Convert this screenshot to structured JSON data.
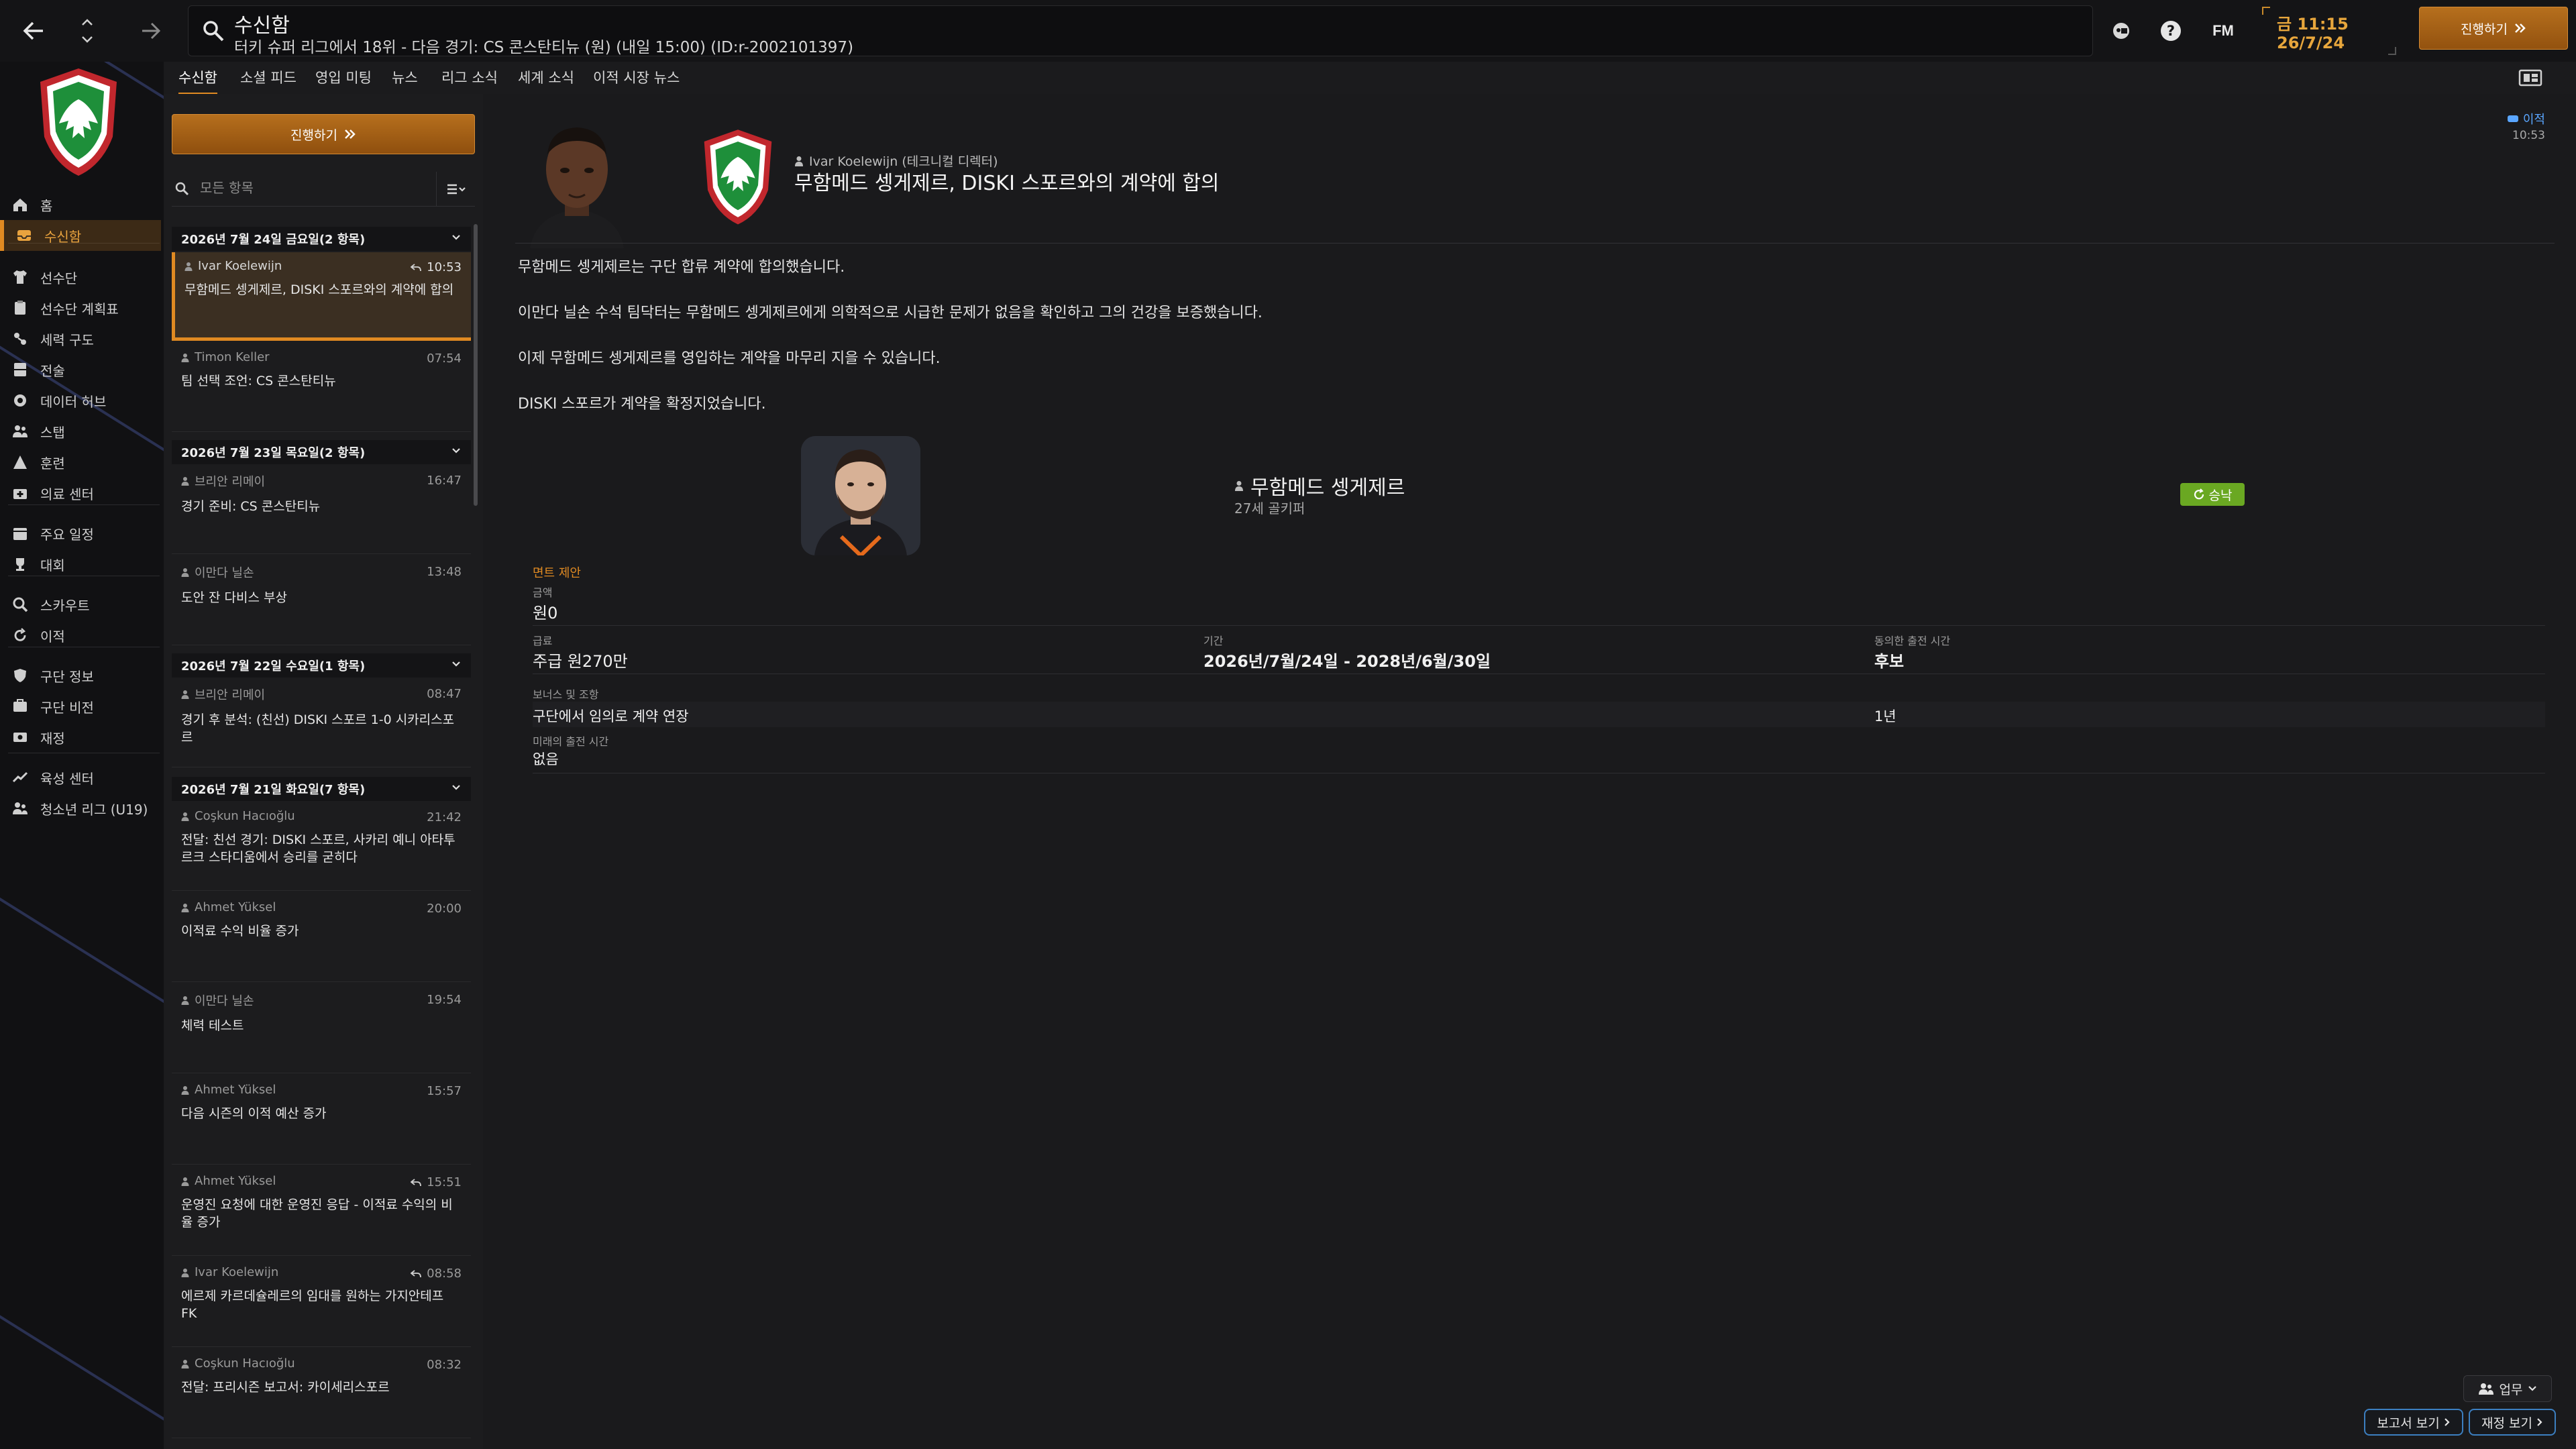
{
  "topbar": {
    "title": "수신함",
    "subtitle": "터키 슈퍼 리그에서 18위 - 다음 경기: CS 콘스탄티뉴 (원) (내일 15:00) (ID:r-2002101397)",
    "fm_logo": "FM",
    "time": "금 11:15",
    "date": "26/7/24",
    "continue_label": "진행하기"
  },
  "sidebar": {
    "items": [
      {
        "label": "홈",
        "icon": "home-icon"
      },
      {
        "label": "수신함",
        "icon": "inbox-icon",
        "active": true
      },
      {
        "label": "선수단",
        "icon": "shirt-icon"
      },
      {
        "label": "선수단 계획표",
        "icon": "clipboard-icon"
      },
      {
        "label": "세력 구도",
        "icon": "dynamics-icon"
      },
      {
        "label": "전술",
        "icon": "tactics-icon"
      },
      {
        "label": "데이터 허브",
        "icon": "data-hub-icon"
      },
      {
        "label": "스탭",
        "icon": "staff-icon"
      },
      {
        "label": "훈련",
        "icon": "training-icon"
      },
      {
        "label": "의료 센터",
        "icon": "medical-icon"
      },
      {
        "label": "주요 일정",
        "icon": "calendar-icon"
      },
      {
        "label": "대회",
        "icon": "trophy-icon"
      },
      {
        "label": "스카우트",
        "icon": "scout-icon"
      },
      {
        "label": "이적",
        "icon": "transfer-icon"
      },
      {
        "label": "구단 정보",
        "icon": "shield-icon"
      },
      {
        "label": "구단 비전",
        "icon": "vision-icon"
      },
      {
        "label": "재정",
        "icon": "finance-icon"
      },
      {
        "label": "육성 센터",
        "icon": "development-icon"
      },
      {
        "label": "청소년 리그 (U19)",
        "icon": "youth-icon"
      }
    ]
  },
  "tabs": [
    "수신함",
    "소셜 피드",
    "영입 미팅",
    "뉴스",
    "리그 소식",
    "세계 소식",
    "이적 시장 뉴스"
  ],
  "inbox": {
    "continue_label": "진행하기",
    "filter_placeholder": "모든 항목",
    "groups": [
      {
        "header": "2026년 7월 24일 금요일(2 항목)",
        "messages": [
          {
            "sender": "Ivar Koelewijn",
            "time": "10:53",
            "subject": "무함메드 셍게제르, DISKI 스포르와의 계약에 합의",
            "selected": true,
            "replied": true
          },
          {
            "sender": "Timon Keller",
            "time": "07:54",
            "subject": "팀 선택 조언: CS 콘스탄티뉴"
          }
        ]
      },
      {
        "header": "2026년 7월 23일 목요일(2 항목)",
        "messages": [
          {
            "sender": "브리안 리메이",
            "time": "16:47",
            "subject": "경기 준비: CS 콘스탄티뉴"
          },
          {
            "sender": "이만다 닐손",
            "time": "13:48",
            "subject": "도안 잔 다비스 부상"
          }
        ]
      },
      {
        "header": "2026년 7월 22일 수요일(1 항목)",
        "messages": [
          {
            "sender": "브리안 리메이",
            "time": "08:47",
            "subject": "경기 후 분석: (친선) DISKI 스포르 1-0 시카리스포르"
          }
        ]
      },
      {
        "header": "2026년 7월 21일 화요일(7 항목)",
        "messages": [
          {
            "sender": "Coşkun Hacıoğlu",
            "time": "21:42",
            "subject": "전달: 친선 경기: DISKI 스포르, 사카리 예니 아타투르크 스타디움에서 승리를 굳히다"
          },
          {
            "sender": "Ahmet Yüksel",
            "time": "20:00",
            "subject": "이적료 수익 비율 증가"
          },
          {
            "sender": "이만다 닐손",
            "time": "19:54",
            "subject": "체력 테스트"
          },
          {
            "sender": "Ahmet Yüksel",
            "time": "15:57",
            "subject": "다음 시즌의 이적 예산 증가"
          },
          {
            "sender": "Ahmet Yüksel",
            "time": "15:51",
            "subject": "운영진 요청에 대한 운영진 응답 - 이적료 수익의 비율 증가",
            "replied": true
          },
          {
            "sender": "Ivar Koelewijn",
            "time": "08:58",
            "subject": "에르제 카르데슐레르의 임대를 원하는 가지안테프 FK",
            "replied": true
          },
          {
            "sender": "Coşkun Hacıoğlu",
            "time": "08:32",
            "subject": "전달: 프리시즌 보고서: 카이세리스포르"
          }
        ]
      }
    ]
  },
  "message": {
    "sender": "Ivar Koelewijn (테크니컬 디렉터)",
    "title": "무함메드 셍게제르, DISKI 스포르와의 계약에 합의",
    "tag": "이적",
    "time": "10:53",
    "paragraphs": [
      "무함메드 셍게제르는 구단 합류 계약에 합의했습니다.",
      "이만다 닐손 수석 팀닥터는 무함메드 셍게제르에게 의학적으로 시급한 문제가 없음을 확인하고 그의 건강을 보증했습니다.",
      "이제 무함메드 셍게제르를 영입하는 계약을 마무리 지을 수 있습니다.",
      "DISKI 스포르가 계약을 확정지었습니다."
    ],
    "card": {
      "player_name": "무함메드 셍게제르",
      "player_sub": "27세 골키퍼",
      "status": "승낙",
      "clause_title": "면트 제안",
      "fee_label": "금액",
      "fee_value": "원0",
      "wage_label": "급료",
      "wage_value": "주급 원270만",
      "period_label": "기간",
      "period_value": "2026년/7월/24일 - 2028년/6월/30일",
      "role_label": "동의한 출전 시간",
      "role_value": "후보",
      "bonus_label": "보너스 및 조항",
      "bonus_name": "구단에서 임의로 계약 연장",
      "bonus_value": "1년",
      "future_label": "미래의 출전 시간",
      "future_value": "없음"
    }
  },
  "bottom": {
    "duty_label": "업무",
    "report_label": "보고서 보기",
    "finance_label": "재정 보기"
  },
  "colors": {
    "accent": "#e08a22",
    "accept": "#6aa822",
    "link": "#5aa6ff",
    "club_green": "#1e8f3a",
    "club_red": "#c1272d"
  }
}
